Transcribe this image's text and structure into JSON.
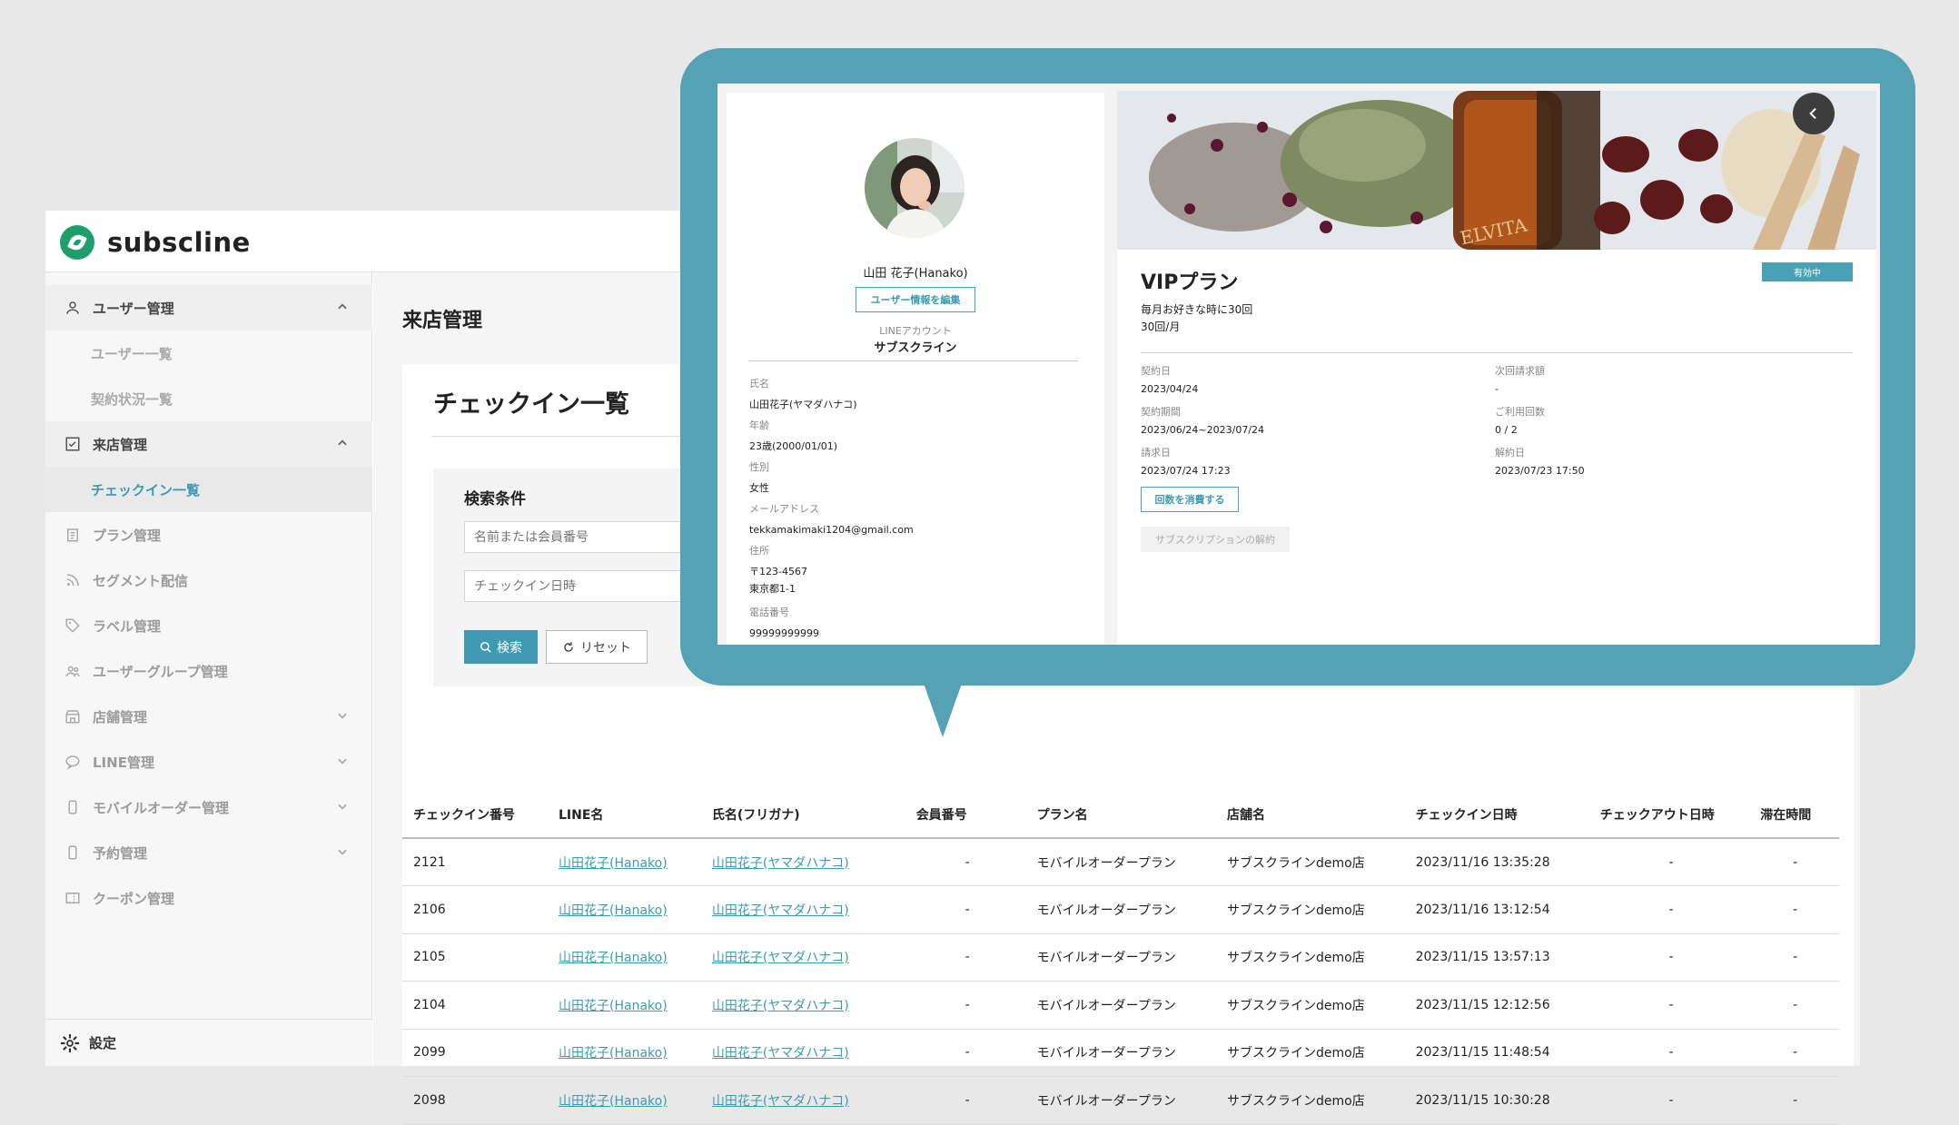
{
  "app": {
    "logo_text": "subscline"
  },
  "sidebar": {
    "items": [
      {
        "label": "ユーザー管理",
        "type": "parent",
        "icon": "user-icon",
        "chevron": "up"
      },
      {
        "label": "ユーザー一覧",
        "type": "sub"
      },
      {
        "label": "契約状況一覧",
        "type": "sub"
      },
      {
        "label": "来店管理",
        "type": "parent",
        "icon": "checklist-icon",
        "chevron": "up"
      },
      {
        "label": "チェックイン一覧",
        "type": "sub-active"
      },
      {
        "label": "プラン管理",
        "type": "item",
        "icon": "clipboard-icon"
      },
      {
        "label": "セグメント配信",
        "type": "item",
        "icon": "rss-icon"
      },
      {
        "label": "ラベル管理",
        "type": "item",
        "icon": "tag-icon"
      },
      {
        "label": "ユーザーグループ管理",
        "type": "item",
        "icon": "users-icon"
      },
      {
        "label": "店舗管理",
        "type": "item",
        "icon": "store-icon",
        "chevron": "down"
      },
      {
        "label": "LINE管理",
        "type": "item",
        "icon": "chat-icon",
        "chevron": "down"
      },
      {
        "label": "モバイルオーダー管理",
        "type": "item",
        "icon": "mobile-icon",
        "chevron": "down"
      },
      {
        "label": "予約管理",
        "type": "item",
        "icon": "mobile-icon",
        "chevron": "down"
      },
      {
        "label": "クーポン管理",
        "type": "item",
        "icon": "coupon-icon"
      }
    ],
    "settings_label": "設定"
  },
  "main": {
    "page_title": "来店管理",
    "card_title": "チェックイン一覧",
    "search": {
      "label": "検索条件",
      "name_placeholder": "名前または会員番号",
      "date_placeholder": "チェックイン日時",
      "search_button": "検索",
      "reset_button": "リセット"
    },
    "table": {
      "columns": [
        "チェックイン番号",
        "LINE名",
        "氏名(フリガナ)",
        "会員番号",
        "プラン名",
        "店舗名",
        "チェックイン日時",
        "チェックアウト日時",
        "滞在時間"
      ],
      "rows": [
        [
          "2121",
          "山田花子(Hanako)",
          "山田花子(ヤマダハナコ)",
          "-",
          "モバイルオーダープラン",
          "サブスクラインdemo店",
          "2023/11/16 13:35:28",
          "-",
          "-"
        ],
        [
          "2106",
          "山田花子(Hanako)",
          "山田花子(ヤマダハナコ)",
          "-",
          "モバイルオーダープラン",
          "サブスクラインdemo店",
          "2023/11/16 13:12:54",
          "-",
          "-"
        ],
        [
          "2105",
          "山田花子(Hanako)",
          "山田花子(ヤマダハナコ)",
          "-",
          "モバイルオーダープラン",
          "サブスクラインdemo店",
          "2023/11/15 13:57:13",
          "-",
          "-"
        ],
        [
          "2104",
          "山田花子(Hanako)",
          "山田花子(ヤマダハナコ)",
          "-",
          "モバイルオーダープラン",
          "サブスクラインdemo店",
          "2023/11/15 12:12:56",
          "-",
          "-"
        ],
        [
          "2099",
          "山田花子(Hanako)",
          "山田花子(ヤマダハナコ)",
          "-",
          "モバイルオーダープラン",
          "サブスクラインdemo店",
          "2023/11/15 11:48:54",
          "-",
          "-"
        ],
        [
          "2098",
          "山田花子(Hanako)",
          "山田花子(ヤマダハナコ)",
          "-",
          "モバイルオーダープラン",
          "サブスクラインdemo店",
          "2023/11/15 10:30:28",
          "-",
          "-"
        ]
      ]
    }
  },
  "profile": {
    "name": "山田 花子(Hanako)",
    "edit_button": "ユーザー情報を編集",
    "line_account_label": "LINEアカウント",
    "line_account_value": "サブスクライン",
    "fields": [
      {
        "label": "氏名",
        "value": "山田花子(ヤマダハナコ)"
      },
      {
        "label": "年齢",
        "value": "23歳(2000/01/01)"
      },
      {
        "label": "性別",
        "value": "女性"
      },
      {
        "label": "メールアドレス",
        "value": "tekkamakimaki1204@gmail.com"
      },
      {
        "label": "住所",
        "value": "〒123-4567",
        "value2": "東京都1-1"
      },
      {
        "label": "電話番号",
        "value": "99999999999"
      }
    ]
  },
  "plan": {
    "title": "VIPプラン",
    "status": "有効中",
    "desc_line1": "毎月お好きな時に30回",
    "desc_line2": "30回/月",
    "bottle_text": "ELVITA",
    "fields_left": [
      {
        "label": "契約日",
        "value": "2023/04/24"
      },
      {
        "label": "契約期間",
        "value": "2023/06/24~2023/07/24"
      },
      {
        "label": "請求日",
        "value": "2023/07/24 17:23"
      }
    ],
    "fields_right": [
      {
        "label": "次回請求額",
        "value": "-"
      },
      {
        "label": "ご利用回数",
        "value": "0 / 2"
      },
      {
        "label": "解約日",
        "value": "2023/07/23 17:50"
      }
    ],
    "consume_button": "回数を消費する",
    "cancel_button": "サブスクリプションの解約"
  },
  "colors": {
    "accent": "#3f99b0",
    "callout": "#55a2b5",
    "brand": "#1e9e6a"
  }
}
